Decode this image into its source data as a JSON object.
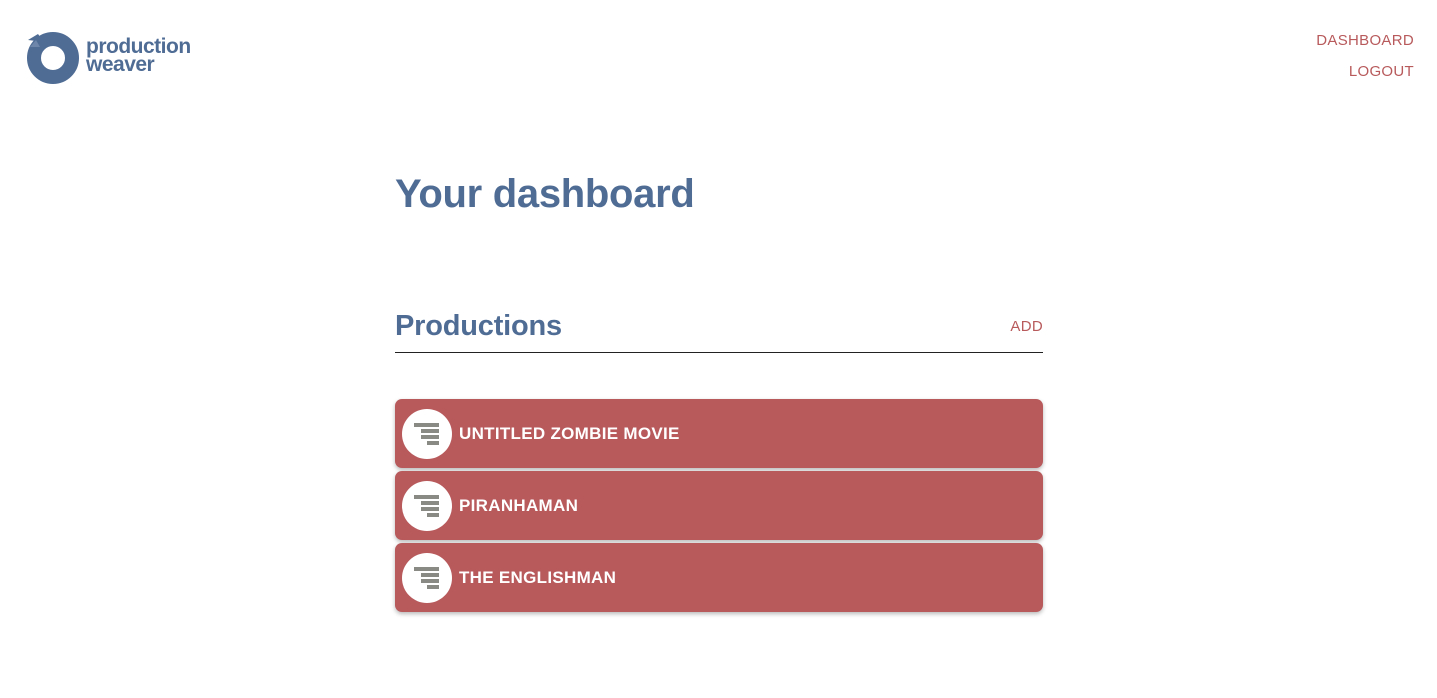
{
  "brand": {
    "line1": "production",
    "line2": "weaver",
    "color": "#4f6c95"
  },
  "nav": {
    "dashboard_label": "DASHBOARD",
    "logout_label": "LOGOUT",
    "color": "#b85a5c"
  },
  "main": {
    "title": "Your dashboard",
    "productions": {
      "heading": "Productions",
      "add_label": "ADD",
      "items": [
        {
          "label": "UNTITLED ZOMBIE MOVIE",
          "icon": "script-lines-icon"
        },
        {
          "label": "PIRANHAMAN",
          "icon": "script-lines-icon"
        },
        {
          "label": "THE ENGLISHMAN",
          "icon": "script-lines-icon"
        }
      ],
      "item_color": "#b8595c"
    }
  }
}
